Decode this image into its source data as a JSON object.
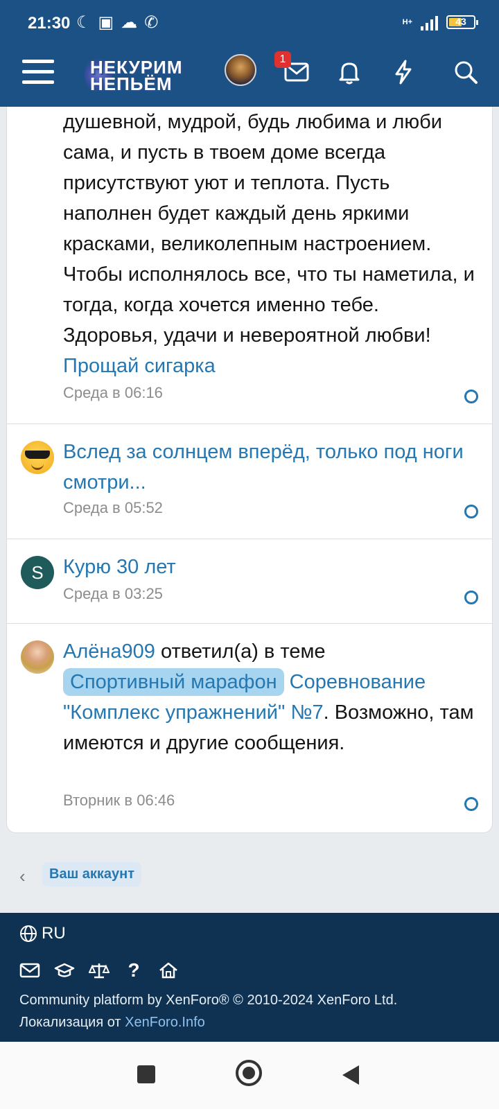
{
  "status_bar": {
    "time": "21:30",
    "icons": [
      "moon-icon",
      "battery-saver-icon",
      "cloud-icon",
      "viber-icon"
    ],
    "network": "H+",
    "battery": "43"
  },
  "header": {
    "logo_line1": "НЕКУРИМ",
    "logo_line2": "НЕПЬЁМ",
    "inbox_badge": "1",
    "icons": [
      "menu-icon",
      "inbox-icon",
      "bell-icon",
      "lightning-icon",
      "search-icon"
    ]
  },
  "alerts": [
    {
      "text": "душевной, мудрой, будь любима и люби сама, и пусть в твоем доме всегда присутствуют уют и теплота. Пусть наполнен будет каждый день яркими красками, великолепным настроением. Чтобы исполнялось все, что ты наметила, и тогда, когда хочется именно тебе. Здоровья, удачи и невероятной любви!",
      "link": "Прощай сигарка",
      "time": "Среда в 06:16"
    },
    {
      "link": "Вслед за солнцем вперёд, только под ноги смотри...",
      "time": "Среда в 05:52"
    },
    {
      "avatar_letter": "S",
      "link": "Курю 30 лет",
      "time": "Среда в 03:25"
    },
    {
      "user": "Алёна909",
      "action": "ответил(а) в теме",
      "prefix": "Спортивный марафон",
      "thread": "Соревнование \"Комплекс упражнений\" №7",
      "suffix": ". Возможно, там имеются и другие сообщения.",
      "time": "Вторник в 06:46"
    }
  ],
  "breadcrumb": {
    "label": "Ваш аккаунт"
  },
  "footer": {
    "language": "RU",
    "icons": [
      "mail-icon",
      "graduation-cap-icon",
      "scales-icon",
      "help-icon",
      "home-icon"
    ],
    "copyright": "Community platform by XenForo® © 2010-2024 XenForo Ltd.",
    "localization_prefix": "Локализация от",
    "localization_link": "XenForo.Info"
  },
  "colors": {
    "header_bg": "#1b5185",
    "footer_bg": "#0f3152",
    "link": "#2577b1",
    "prefix_bg": "#a7d4ee"
  }
}
